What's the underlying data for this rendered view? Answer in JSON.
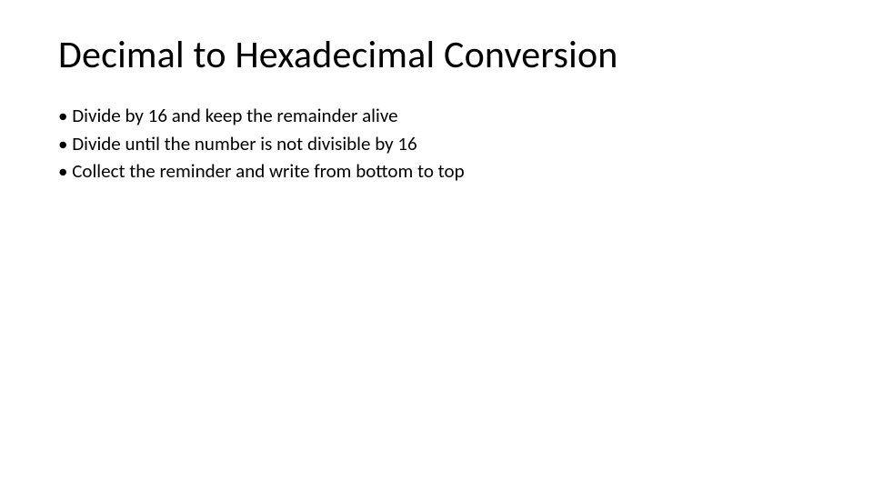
{
  "slide": {
    "title": "Decimal to Hexadecimal Conversion",
    "bullets": [
      "Divide by 16 and keep the remainder alive",
      "Divide until the number is not divisible by 16",
      "Collect the reminder and write from bottom to top"
    ]
  }
}
